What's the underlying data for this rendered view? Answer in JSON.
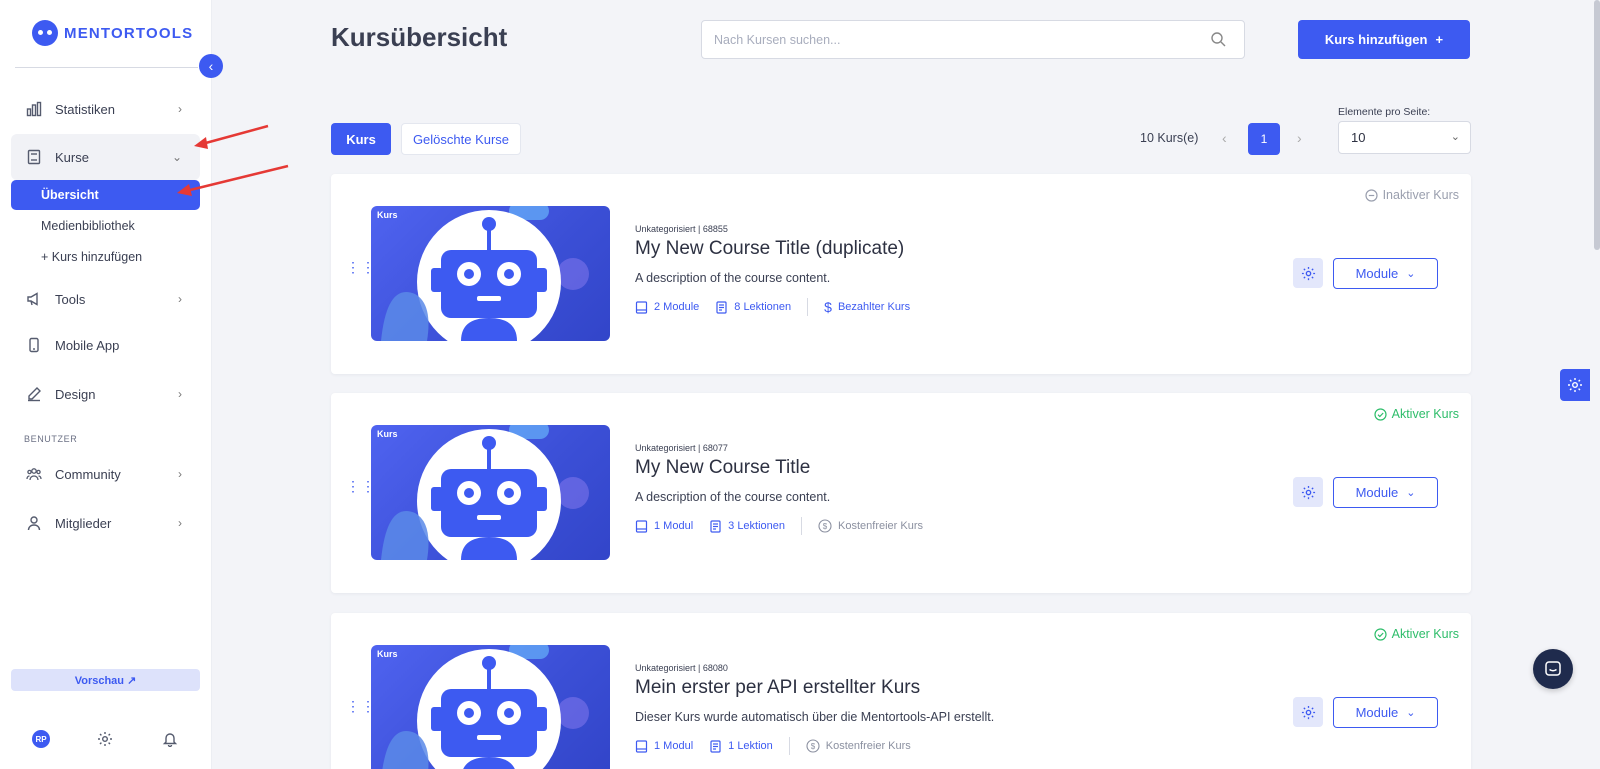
{
  "app": {
    "brand": "MENTORTOOLS"
  },
  "sidebar": {
    "items": [
      {
        "label": "Statistiken",
        "icon": "bar-chart-icon"
      },
      {
        "label": "Kurse",
        "icon": "book-icon"
      },
      {
        "label": "Tools",
        "icon": "megaphone-icon"
      },
      {
        "label": "Mobile App",
        "icon": "smartphone-icon"
      },
      {
        "label": "Design",
        "icon": "pencil-icon"
      },
      {
        "label": "Community",
        "icon": "users-icon"
      },
      {
        "label": "Mitglieder",
        "icon": "user-icon"
      }
    ],
    "sub_items": [
      "Übersicht",
      "Medienbibliothek",
      "+ Kurs hinzufügen"
    ],
    "section_label": "BENUTZER",
    "preview_label": "Vorschau ↗",
    "avatar_initials": "RP"
  },
  "header": {
    "title": "Kursübersicht",
    "search_placeholder": "Nach Kursen suchen...",
    "add_label": "Kurs hinzufügen"
  },
  "tabs": {
    "active": "Kurs",
    "other": "Gelöschte Kurse"
  },
  "pagination": {
    "count_label": "10 Kurs(e)",
    "current_page": "1",
    "per_page_label": "Elemente pro Seite:",
    "per_page_value": "10"
  },
  "courses": [
    {
      "badge": "Kurs",
      "meta": "Unkategorisiert | 68855",
      "title": "My New Course Title (duplicate)",
      "description": "A description of the course content.",
      "modules": "2 Module",
      "lessons": "8 Lektionen",
      "price": "Bezahlter Kurs",
      "status": "Inaktiver Kurs",
      "module_button": "Module"
    },
    {
      "badge": "Kurs",
      "meta": "Unkategorisiert | 68077",
      "title": "My New Course Title",
      "description": "A description of the course content.",
      "modules": "1 Modul",
      "lessons": "3 Lektionen",
      "price": "Kostenfreier Kurs",
      "status": "Aktiver Kurs",
      "module_button": "Module"
    },
    {
      "badge": "Kurs",
      "meta": "Unkategorisiert | 68080",
      "title": "Mein erster per API erstellter Kurs",
      "description": "Dieser Kurs wurde automatisch über die Mentortools-API erstellt.",
      "modules": "1 Modul",
      "lessons": "1 Lektion",
      "price": "Kostenfreier Kurs",
      "status": "Aktiver Kurs",
      "module_button": "Module"
    }
  ],
  "colors": {
    "accent": "#3d5af1",
    "active_status": "#2ebd6a",
    "inactive_status": "#9a9fae",
    "annotation": "#e53935"
  }
}
